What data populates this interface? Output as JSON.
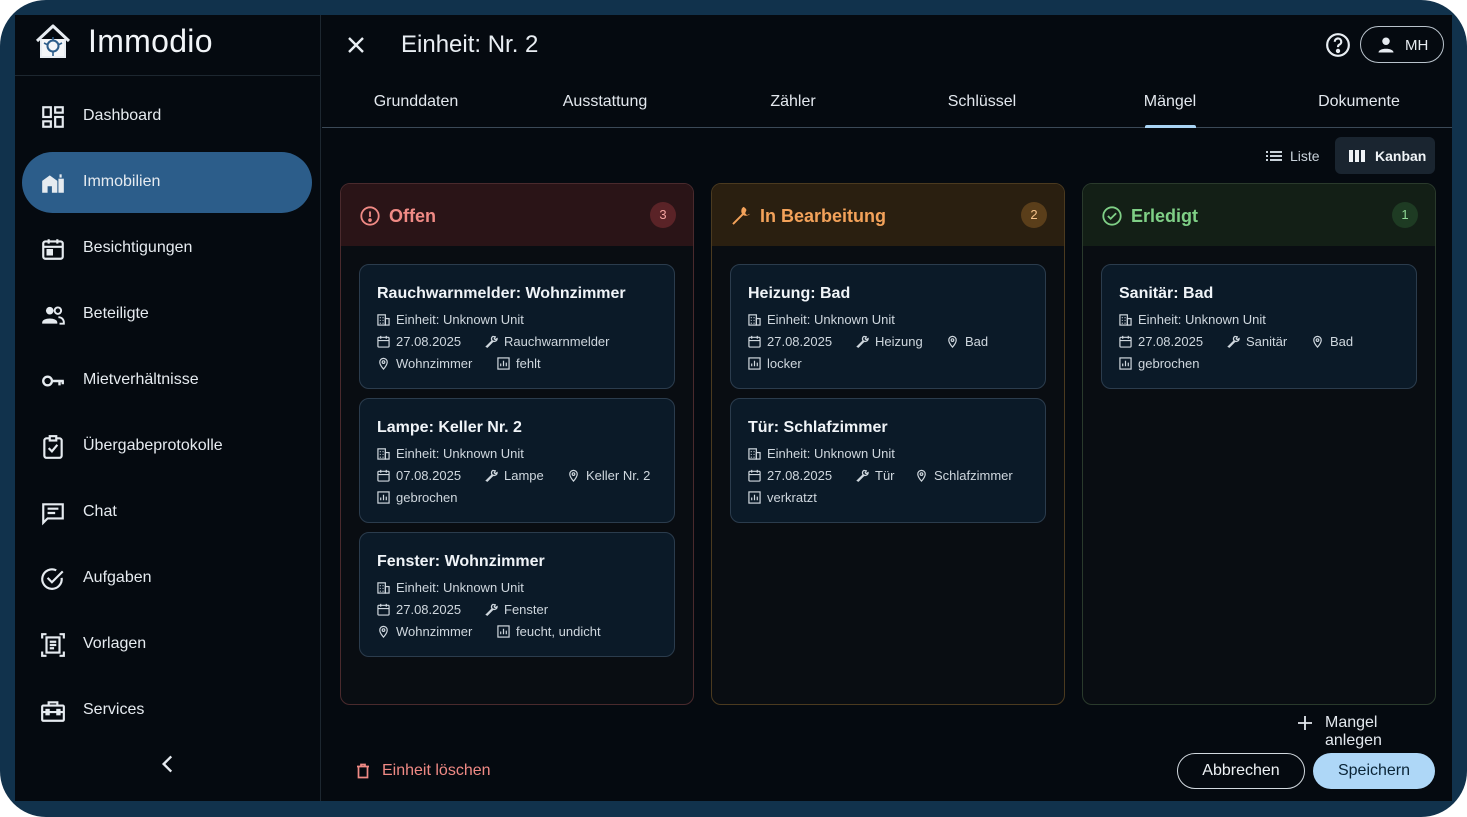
{
  "app": {
    "name": "Immodio"
  },
  "sidebar": {
    "items": [
      {
        "label": "Dashboard",
        "icon": "dashboard-icon"
      },
      {
        "label": "Immobilien",
        "icon": "buildings-icon",
        "active": true
      },
      {
        "label": "Besichtigungen",
        "icon": "calendar-icon"
      },
      {
        "label": "Beteiligte",
        "icon": "people-icon"
      },
      {
        "label": "Mietverhältnisse",
        "icon": "key-icon"
      },
      {
        "label": "Übergabeprotokolle",
        "icon": "clipboard-check-icon"
      },
      {
        "label": "Chat",
        "icon": "chat-icon"
      },
      {
        "label": "Aufgaben",
        "icon": "check-circle-icon"
      },
      {
        "label": "Vorlagen",
        "icon": "template-icon"
      },
      {
        "label": "Services",
        "icon": "toolbox-icon"
      }
    ]
  },
  "header": {
    "title": "Einheit: Nr. 2",
    "user_initials": "MH"
  },
  "tabs": [
    {
      "label": "Grunddaten"
    },
    {
      "label": "Ausstattung"
    },
    {
      "label": "Zähler"
    },
    {
      "label": "Schlüssel"
    },
    {
      "label": "Mängel",
      "active": true
    },
    {
      "label": "Dokumente"
    }
  ],
  "view": {
    "list_label": "Liste",
    "kanban_label": "Kanban",
    "selected": "Kanban"
  },
  "columns": [
    {
      "title": "Offen",
      "count": "3",
      "color": "#f08a85",
      "cards": [
        {
          "title": "Rauchwarnmelder: Wohnzimmer",
          "unit": "Einheit: Unknown Unit",
          "date": "27.08.2025",
          "item": "Rauchwarnmelder",
          "room": "Wohnzimmer",
          "damage": "fehlt"
        },
        {
          "title": "Lampe: Keller Nr. 2",
          "unit": "Einheit: Unknown Unit",
          "date": "07.08.2025",
          "item": "Lampe",
          "room": "Keller Nr. 2",
          "damage": "gebrochen"
        },
        {
          "title": "Fenster: Wohnzimmer",
          "unit": "Einheit: Unknown Unit",
          "date": "27.08.2025",
          "item": "Fenster",
          "room": "Wohnzimmer",
          "damage": "feucht, undicht"
        }
      ]
    },
    {
      "title": "In Bearbeitung",
      "count": "2",
      "color": "#f3a25a",
      "cards": [
        {
          "title": "Heizung: Bad",
          "unit": "Einheit: Unknown Unit",
          "date": "27.08.2025",
          "item": "Heizung",
          "room": "Bad",
          "damage": "locker"
        },
        {
          "title": "Tür: Schlafzimmer",
          "unit": "Einheit: Unknown Unit",
          "date": "27.08.2025",
          "item": "Tür",
          "room": "Schlafzimmer",
          "damage": "verkratzt"
        }
      ]
    },
    {
      "title": "Erledigt",
      "count": "1",
      "color": "#7fcf86",
      "cards": [
        {
          "title": "Sanitär: Bad",
          "unit": "Einheit: Unknown Unit",
          "date": "27.08.2025",
          "item": "Sanitär",
          "room": "Bad",
          "damage": "gebrochen"
        }
      ]
    }
  ],
  "actions": {
    "add_label": "Mangel anlegen",
    "delete_label": "Einheit löschen",
    "cancel_label": "Abbrechen",
    "save_label": "Speichern"
  }
}
